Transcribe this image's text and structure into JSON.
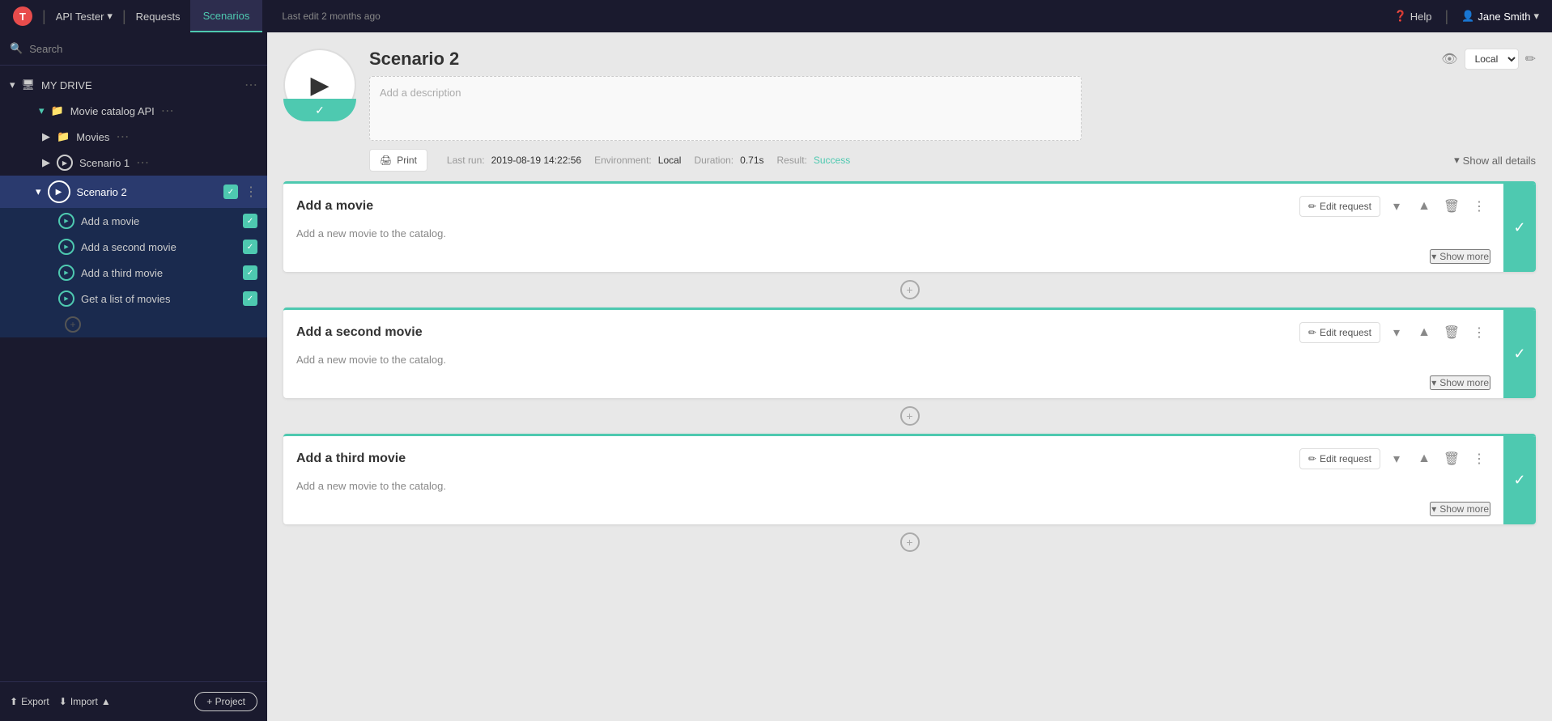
{
  "topNav": {
    "logo": "T",
    "appName": "API Tester",
    "separator1": "|",
    "requests": "Requests",
    "separator2": "|",
    "scenarios": "Scenarios",
    "lastEdit": "Last edit 2 months ago",
    "help": "Help",
    "user": "Jane Smith"
  },
  "sidebar": {
    "searchPlaceholder": "Search",
    "myDrive": "MY DRIVE",
    "collection": "Movie catalog API",
    "movies": "Movies",
    "scenario1": "Scenario 1",
    "scenario2": "Scenario 2",
    "subItems": [
      {
        "label": "Add a movie",
        "checked": true
      },
      {
        "label": "Add a second movie",
        "checked": true
      },
      {
        "label": "Add a third movie",
        "checked": true
      },
      {
        "label": "Get a list of movies",
        "checked": true
      }
    ],
    "export": "Export",
    "import": "Import",
    "project": "+ Project"
  },
  "scenario": {
    "title": "Scenario 2",
    "descriptionPlaceholder": "Add a description",
    "lastRun": "2019-08-19 14:22:56",
    "duration": "0.71s",
    "environment": "Local",
    "result": "Success",
    "printLabel": "Print",
    "showAllDetails": "Show all details",
    "envLabel": "Local"
  },
  "cards": [
    {
      "title": "Add a movie",
      "description": "Add a new movie to the catalog.",
      "editRequest": "Edit request",
      "showMore": "Show more"
    },
    {
      "title": "Add a second movie",
      "description": "Add a new movie to the catalog.",
      "editRequest": "Edit request",
      "showMore": "Show more"
    },
    {
      "title": "Add a third movie",
      "description": "Add a new movie to the catalog.",
      "editRequest": "Edit request",
      "showMore": "Show more"
    }
  ]
}
